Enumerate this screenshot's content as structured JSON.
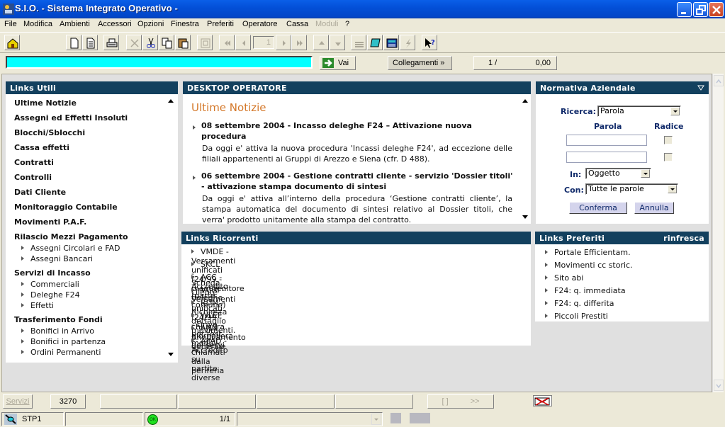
{
  "window": {
    "title": "S.I.O. - Sistema Integrato Operativo -",
    "controls": [
      "minimize",
      "restore",
      "close"
    ]
  },
  "menu": {
    "items": [
      {
        "label": "File",
        "enabled": true
      },
      {
        "label": "Modifica",
        "enabled": true
      },
      {
        "label": "Ambienti",
        "enabled": true
      },
      {
        "label": "Accessori",
        "enabled": true
      },
      {
        "label": "Opzioni",
        "enabled": true
      },
      {
        "label": "Finestra",
        "enabled": true
      },
      {
        "label": "Preferiti",
        "enabled": true
      },
      {
        "label": "Operatore",
        "enabled": true
      },
      {
        "label": "Cassa",
        "enabled": true
      },
      {
        "label": "Moduli",
        "enabled": false
      },
      {
        "label": "?",
        "enabled": true
      }
    ]
  },
  "toolbar": {
    "icons": [
      "home-icon",
      "new-document-icon",
      "document-icon",
      "print-icon",
      "delete-icon",
      "cut-icon",
      "copy-icon",
      "paste-icon",
      "archive-icon",
      "first-page-icon",
      "prev-page-icon",
      "next-page-icon",
      "last-page-icon",
      "up-icon",
      "down-icon",
      "stack-icon",
      "notepad-icon",
      "calculator-icon",
      "lightning-icon",
      "context-help-icon"
    ],
    "page_value": "1"
  },
  "command_bar": {
    "input_value": "",
    "go_label": "Vai",
    "links_label": "Collegamenti »",
    "counter_left": "1 /",
    "counter_right": "0,00",
    "input_color": "#00ffff"
  },
  "links_utili": {
    "title": "Links Utili",
    "items": [
      {
        "label": "Ultime Notizie"
      },
      {
        "label": "Assegni ed Effetti Insoluti"
      },
      {
        "label": "Blocchi/Sblocchi"
      },
      {
        "label": "Cassa effetti"
      },
      {
        "label": "Contratti"
      },
      {
        "label": "Controlli"
      },
      {
        "label": "Dati Cliente"
      },
      {
        "label": "Monitoraggio Contabile"
      },
      {
        "label": "Movimenti P.A.F."
      }
    ],
    "groups": [
      {
        "label": "Rilascio Mezzi Pagamento",
        "subitems": [
          "Assegni Circolari e FAD",
          "Assegni Bancari"
        ]
      },
      {
        "label": "Servizi di Incasso",
        "subitems": [
          "Commerciali",
          "Deleghe F24",
          "Effetti"
        ]
      },
      {
        "label": "Trasferimento Fondi",
        "subitems": [
          "Bonifici in Arrivo",
          "Bonifici in partenza",
          "Ordini Permanenti"
        ]
      }
    ]
  },
  "desktop": {
    "title": "DESKTOP OPERATORE",
    "section_title": "Ultime Notizie",
    "news": [
      {
        "headline": "08 settembre 2004 - Incasso deleghe F24 – Attivazione nuova procedura",
        "body": "Da oggi e' attiva la nuova procedura 'Incassi deleghe F24', ad eccezione delle filiali appartenenti ai Gruppi di Arezzo e Siena (cfr. D 488)."
      },
      {
        "headline": "06 settembre 2004 - Gestione contratti cliente - servizio 'Dossier titoli' - attivazione stampa documento di sintesi",
        "body": "Da oggi e' attiva all’interno della procedura ‘Gestione contratti cliente’, la stampa automatica del documento di sintesi relativo al Dossier titoli, che verra' prodotto unitamente alla stampa del contratto."
      }
    ]
  },
  "normativa": {
    "title": "Normativa Aziendale",
    "ricerca_label": "Ricerca:",
    "ricerca_value": "Parola",
    "parola_header": "Parola",
    "radice_header": "Radice",
    "word1": "",
    "word2": "",
    "in_label": "In:",
    "in_value": "Oggetto",
    "con_label": "Con:",
    "con_value": "Tutte le parole",
    "confirm_label": "Conferma",
    "cancel_label": "Annulla"
  },
  "links_ricorrenti": {
    "title": "Links Ricorrenti",
    "items": [
      "VMDE - Versamenti unificati f24/99 - manutenitore deleghe",
      "SKCL - Scheda cliente",
      "ACC - Accredito (parte comune)",
      "VCHI - Versamenti unificati f24/99 - chiusura giornaliera del servi",
      "RDM - Richiesta dettaglio movimenti.",
      "WLEF - Drive per test moduli chiamati dalla periferia",
      "ANN - Annullamento generale",
      "APAD - Accredito su partite diverse"
    ]
  },
  "links_preferiti": {
    "title": "Links Preferiti",
    "refresh_label": "rinfresca",
    "items": [
      "Portale Efficientam.",
      "Movimenti cc storic.",
      "Sito abi",
      "F24: q. immediata",
      "F24: q. differita",
      "Piccoli Prestiti"
    ]
  },
  "statusbar": {
    "servizi_label": "Servizi",
    "session_code": "3270",
    "nav_left": "[ ]",
    "nav_right": ">>",
    "station": "STP1",
    "ok_label": "OK",
    "pages": "1/1"
  },
  "colors": {
    "panel_header": "#13405e",
    "news_title": "#d4782a",
    "form_label": "#102a6a"
  }
}
